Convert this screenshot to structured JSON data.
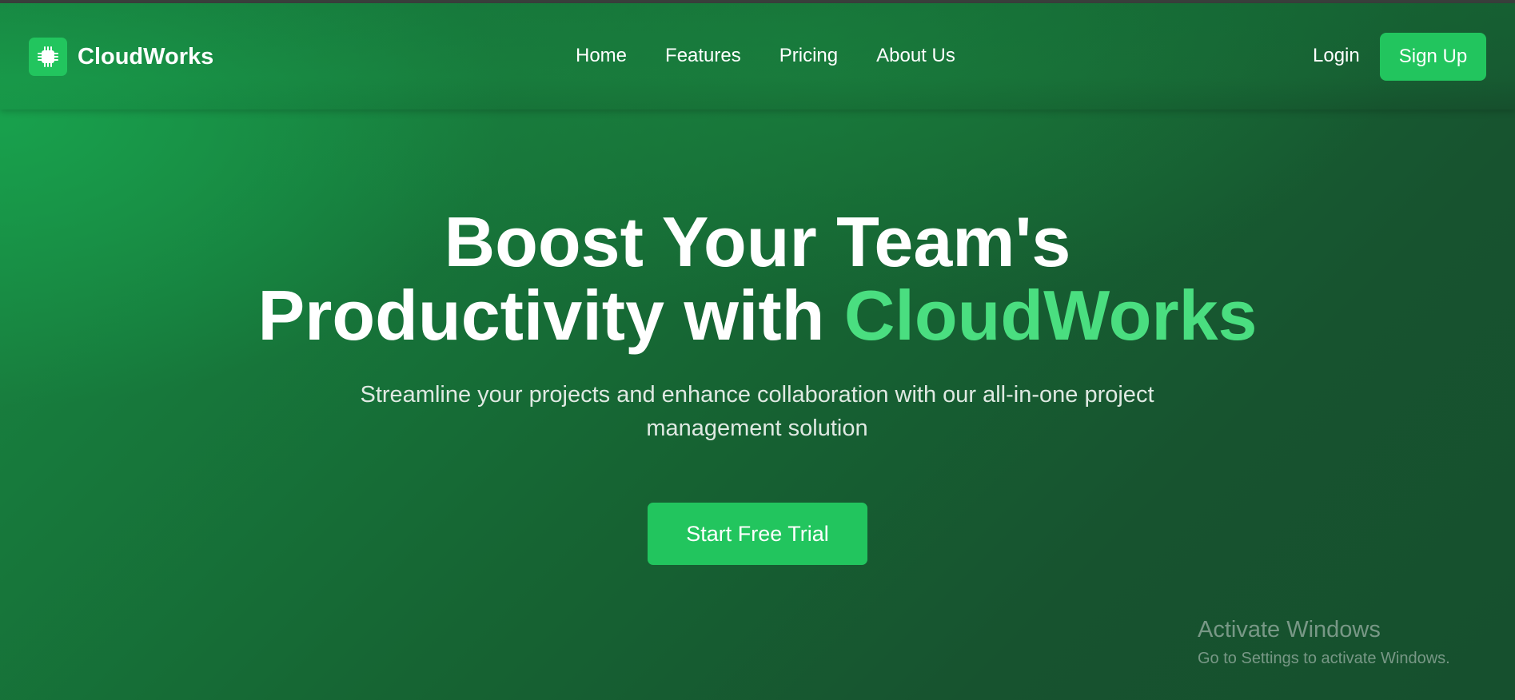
{
  "brand": {
    "name": "CloudWorks",
    "icon": "chip-icon",
    "accent_color": "#22c55e"
  },
  "nav": {
    "links": [
      "Home",
      "Features",
      "Pricing",
      "About Us"
    ],
    "login_label": "Login",
    "signup_label": "Sign Up"
  },
  "hero": {
    "title_line1": "Boost Your Team's",
    "title_line2_prefix": "Productivity with ",
    "title_line2_highlight": "CloudWorks",
    "highlight_color": "#4ade80",
    "subtitle": "Streamline your projects and enhance collaboration with our all-in-one project management solution",
    "cta_label": "Start Free Trial"
  },
  "watermark": {
    "title": "Activate Windows",
    "subtitle": "Go to Settings to activate Windows."
  }
}
